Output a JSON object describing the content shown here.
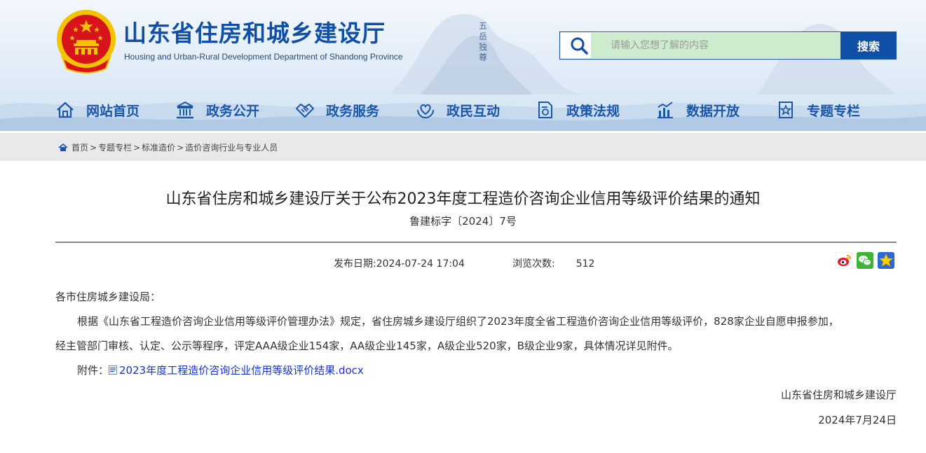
{
  "header": {
    "site_title": "山东省住房和城乡建设厅",
    "site_subtitle": "Housing and Urban-Rural Development Department of Shandong Province",
    "mountain_text": "五岳独尊"
  },
  "search": {
    "placeholder": "请输入您想了解的内容",
    "button_label": "搜索"
  },
  "nav": {
    "items": [
      {
        "label": "网站首页",
        "icon": "home-icon"
      },
      {
        "label": "政务公开",
        "icon": "government-building-icon"
      },
      {
        "label": "政务服务",
        "icon": "handshake-icon"
      },
      {
        "label": "政民互动",
        "icon": "heart-hands-icon"
      },
      {
        "label": "政策法规",
        "icon": "document-seal-icon"
      },
      {
        "label": "数据开放",
        "icon": "bar-chart-icon"
      },
      {
        "label": "专题专栏",
        "icon": "star-document-icon"
      }
    ]
  },
  "breadcrumb": {
    "items": [
      "首页",
      "专题专栏",
      "标准造价",
      "造价咨询行业与专业人员"
    ],
    "separator": ">"
  },
  "article": {
    "title": "山东省住房和城乡建设厅关于公布2023年度工程造价咨询企业信用等级评价结果的通知",
    "doc_number": "鲁建标字〔2024〕7号",
    "publish_label": "发布日期:",
    "publish_date": "2024-07-24 17:04",
    "views_label": "浏览次数:",
    "views": "512",
    "salutation": "各市住房城乡建设局：",
    "body_line1": "根据《山东省工程造价咨询企业信用等级评价管理办法》规定，省住房城乡建设厅组织了2023年度全省工程造价咨询企业信用等级评价，828家企业自愿申报参加，",
    "body_line2": "经主管部门审核、认定、公示等程序，评定AAA级企业154家，AA级企业145家，A级企业520家，B级企业9家，具体情况详见附件。",
    "attachment_label": "附件：",
    "attachment_name": "2023年度工程造价咨询企业信用等级评价结果.docx",
    "signature": "山东省住房和城乡建设厅",
    "sign_date": "2024年7月24日"
  },
  "share": [
    "weibo-icon",
    "wechat-icon",
    "favorite-star-icon"
  ],
  "colors": {
    "brand_blue": "#0f4fa8",
    "nav_text": "#1a57a8",
    "link": "#1a33c8",
    "search_bg": "#cdeccd",
    "emblem_red": "#d6141a",
    "emblem_gold": "#f3c300"
  }
}
